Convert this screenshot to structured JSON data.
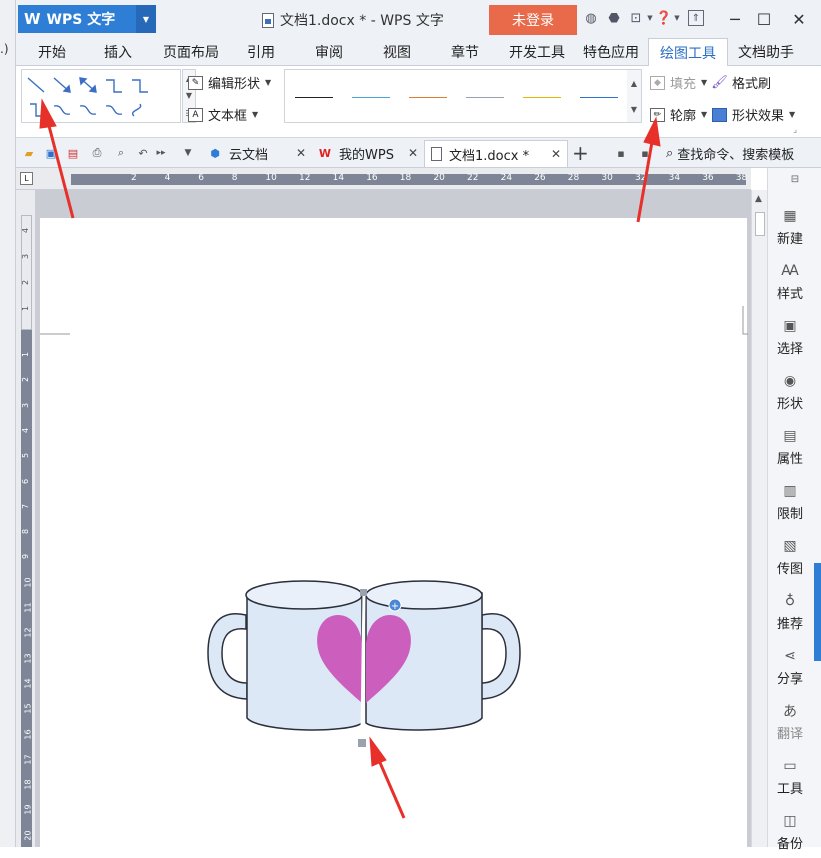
{
  "titlebar": {
    "app_name": "WPS 文字",
    "document_title": "文档1.docx * - WPS 文字",
    "login_button": "未登录",
    "icons": [
      "skin-icon",
      "settings-icon",
      "share-icon",
      "help-icon",
      "collapse-ribbon-icon"
    ],
    "window_controls": [
      "minimize-icon",
      "maximize-icon",
      "close-icon"
    ]
  },
  "menu": {
    "tabs": [
      {
        "label": "开始",
        "active": false
      },
      {
        "label": "插入",
        "active": false
      },
      {
        "label": "页面布局",
        "active": false
      },
      {
        "label": "引用",
        "active": false
      },
      {
        "label": "审阅",
        "active": false
      },
      {
        "label": "视图",
        "active": false
      },
      {
        "label": "章节",
        "active": false
      },
      {
        "label": "开发工具",
        "active": false
      },
      {
        "label": "特色应用",
        "active": false
      },
      {
        "label": "绘图工具",
        "active": true
      },
      {
        "label": "文档助手",
        "active": false
      }
    ]
  },
  "ribbon": {
    "edit_shape": "编辑形状",
    "text_box": "文本框",
    "fill": "填充",
    "format_painter": "格式刷",
    "outline": "轮廓",
    "shape_effects": "形状效果",
    "style_colors": [
      "#222222",
      "#4da3d8",
      "#e07a2c",
      "#9aa3ad",
      "#e8b800",
      "#2e6fcf"
    ]
  },
  "tabbar": {
    "tabs": [
      {
        "label": "云文档",
        "icon": "cloud-doc-icon",
        "active": false
      },
      {
        "label": "我的WPS",
        "icon": "wps-logo-icon",
        "active": false
      },
      {
        "label": "文档1.docx *",
        "icon": "document-icon",
        "active": true
      }
    ],
    "search_placeholder": "查找命令、搜索模板"
  },
  "ruler": {
    "h_labels": [
      "2",
      "4",
      "6",
      "8",
      "10",
      "12",
      "14",
      "16",
      "18",
      "20",
      "22",
      "24",
      "26",
      "28",
      "30",
      "32",
      "34",
      "36",
      "38"
    ],
    "v_labels": [
      "4",
      "3",
      "2",
      "1",
      "1",
      "2",
      "3",
      "4",
      "5",
      "6",
      "7",
      "8",
      "9",
      "10",
      "11",
      "12",
      "13",
      "14",
      "15",
      "16",
      "17",
      "18",
      "19",
      "20"
    ]
  },
  "right_pane": {
    "items": [
      {
        "label": "新建",
        "icon": "new-doc-icon"
      },
      {
        "label": "样式",
        "icon": "style-icon"
      },
      {
        "label": "选择",
        "icon": "select-icon"
      },
      {
        "label": "形状",
        "icon": "shape-icon"
      },
      {
        "label": "属性",
        "icon": "properties-icon"
      },
      {
        "label": "限制",
        "icon": "restrict-icon"
      },
      {
        "label": "传图",
        "icon": "upload-image-icon"
      },
      {
        "label": "推荐",
        "icon": "recommend-icon"
      },
      {
        "label": "分享",
        "icon": "share-icon"
      },
      {
        "label": "翻译",
        "icon": "translate-icon"
      },
      {
        "label": "工具",
        "icon": "toolbox-icon"
      },
      {
        "label": "备份",
        "icon": "backup-icon"
      }
    ]
  },
  "colors": {
    "accent": "#2e7ed6",
    "login_button": "#e86a4a",
    "active_tab_text": "#2a6fc4",
    "mug_fill": "#dce8f5",
    "heart": "#cc5fbe",
    "annotation_arrow": "#e8302a"
  }
}
